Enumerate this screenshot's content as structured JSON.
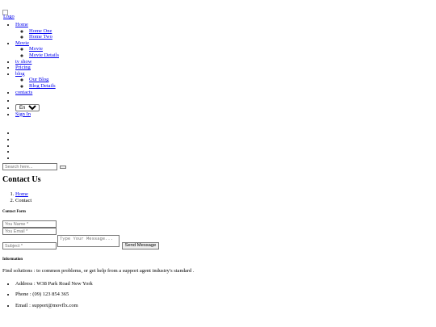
{
  "header": {
    "logo_alt": "Logo",
    "nav": {
      "home": "Home",
      "home_one": "Home One",
      "home_two": "Home Two",
      "movie": "Movie",
      "movie_sub": "Movie",
      "movie_details": "Movie Details",
      "tv_show": "tv show",
      "pricing": "Pricing",
      "blog": "blog",
      "our_blog": "Our Blog",
      "blog_details": "Blog Details",
      "contacts": "contacts"
    },
    "language": {
      "selected": "En"
    },
    "sign_in": "Sign In",
    "search": {
      "placeholder": "Search here..."
    }
  },
  "page": {
    "title": "Contact Us",
    "breadcrumb": {
      "home": "Home",
      "current": "Contact"
    }
  },
  "contact_form": {
    "heading": "Contact Form",
    "name_placeholder": "You Name *",
    "email_placeholder": "You Email *",
    "message_placeholder": "Type Your Message...",
    "subject_placeholder": "Subject *",
    "send_label": "Send Message"
  },
  "information": {
    "heading": "Information",
    "text": "Find solutions : to common problems, or get help from a support agent industry's standard .",
    "address": "Address : W38 Park Road New York",
    "phone": "Phone : (09) 123 854 365",
    "email": "Email : support@movflx.com"
  }
}
